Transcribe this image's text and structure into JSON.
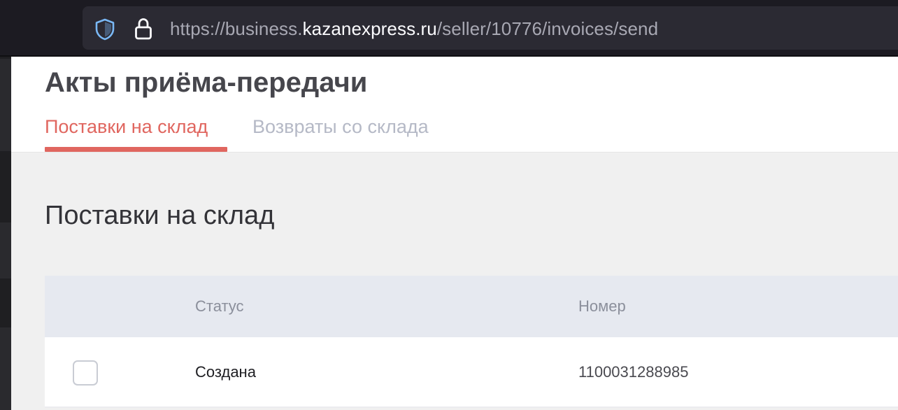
{
  "browser": {
    "url_prefix": "https://business.",
    "url_domain": "kazanexpress.ru",
    "url_path": "/seller/10776/invoices/send"
  },
  "header": {
    "title": "Акты приёма-передачи",
    "tabs": [
      {
        "label": "Поставки на склад",
        "active": true
      },
      {
        "label": "Возвраты со склада",
        "active": false
      }
    ]
  },
  "main": {
    "section_title": "Поставки на склад",
    "table": {
      "columns": [
        "Статус",
        "Номер"
      ],
      "rows": [
        {
          "status": "Создана",
          "number": "1100031288985",
          "checked": false
        }
      ]
    }
  },
  "colors": {
    "accent": "#e0665f",
    "tab_inactive": "#b5b9c6",
    "table_header_bg": "#e6e9f0"
  }
}
